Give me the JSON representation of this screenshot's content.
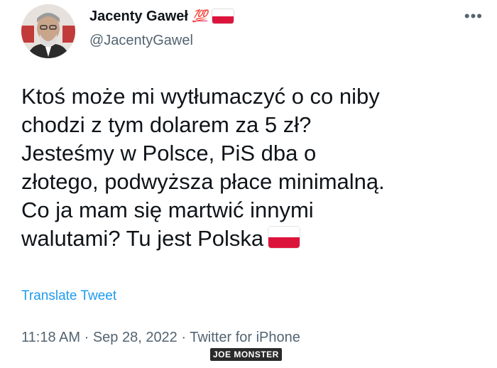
{
  "tweet": {
    "author": {
      "display_name": "Jacenty Gaweł",
      "emoji_hundred": "💯",
      "handle": "@JacentyGawel"
    },
    "more_icon": "more-options-icon",
    "text_lines": [
      "Ktoś może mi wytłumaczyć o co niby",
      "chodzi z tym dolarem za 5 zł?",
      "Jesteśmy w Polsce, PiS dba o",
      "złotego, podwyższa płace minimalną.",
      "Co ja mam się martwić innymi",
      "walutami? Tu jest Polska"
    ],
    "translate_label": "Translate Tweet",
    "time": "11:18 AM",
    "date": "Sep 28, 2022",
    "source": "Twitter for iPhone",
    "separator": " · "
  },
  "watermark": "JOE MONSTER",
  "colors": {
    "text": "#0f1419",
    "secondary": "#536471",
    "link": "#1d9bf0",
    "flag_red": "#dc143c"
  }
}
